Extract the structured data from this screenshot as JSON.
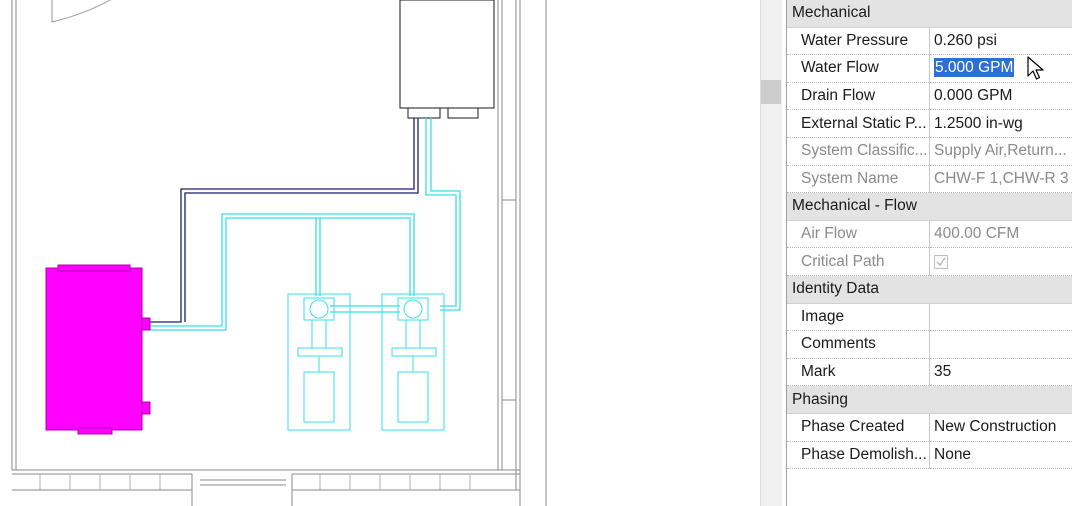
{
  "properties": {
    "groups": [
      {
        "title": "Mechanical",
        "rows": [
          {
            "label": "Water Pressure",
            "value": "0.260 psi",
            "dim": false
          },
          {
            "label": "Water Flow",
            "value": "5.000 GPM",
            "dim": false,
            "selected": true
          },
          {
            "label": "Drain Flow",
            "value": "0.000 GPM",
            "dim": false
          },
          {
            "label": "External Static P...",
            "value": "1.2500 in-wg",
            "dim": false
          },
          {
            "label": "System Classific...",
            "value": "Supply Air,Return...",
            "dim": true
          },
          {
            "label": "System Name",
            "value": "CHW-F 1,CHW-R 3",
            "dim": true
          }
        ]
      },
      {
        "title": "Mechanical - Flow",
        "rows": [
          {
            "label": "Air Flow",
            "value": "400.00 CFM",
            "dim": true
          },
          {
            "label": "Critical Path",
            "value": "",
            "dim": true,
            "checkbox": true,
            "checked": true
          }
        ]
      },
      {
        "title": "Identity Data",
        "rows": [
          {
            "label": "Image",
            "value": "",
            "dim": false
          },
          {
            "label": "Comments",
            "value": "",
            "dim": false
          },
          {
            "label": "Mark",
            "value": "35",
            "dim": false
          }
        ]
      },
      {
        "title": "Phasing",
        "rows": [
          {
            "label": "Phase Created",
            "value": "New Construction",
            "dim": false
          },
          {
            "label": "Phase Demolish...",
            "value": "None",
            "dim": false
          }
        ]
      }
    ]
  },
  "drawing": {
    "equipment_color": "#ff00ff",
    "chilled_pipe_color": "#34e0e8",
    "supply_pipe_color": "#1a1f66",
    "wall_color": "#8a8a8a"
  },
  "cursor": {
    "icon": "arrow-pointer-icon"
  }
}
